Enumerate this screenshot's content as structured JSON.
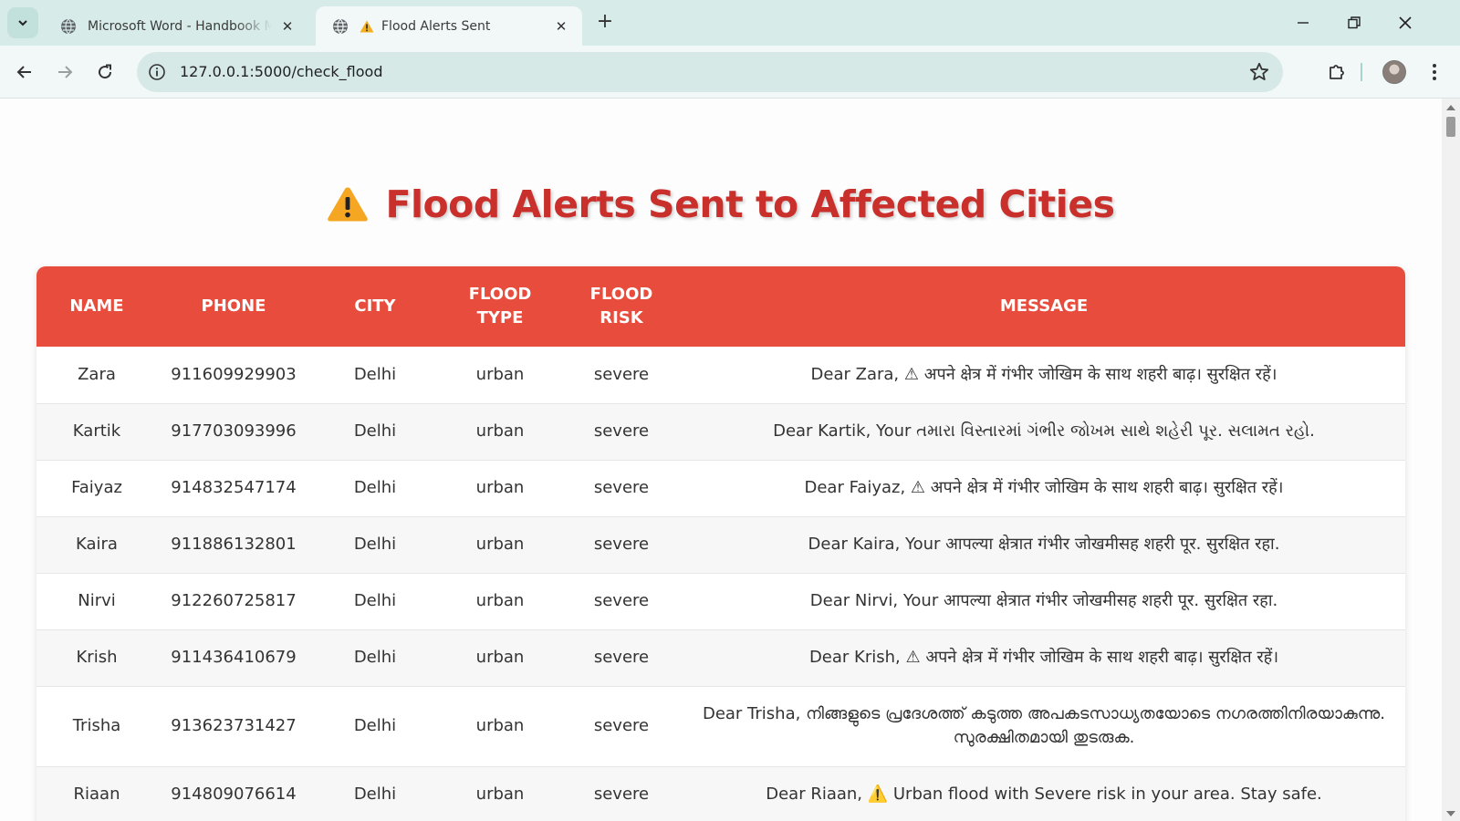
{
  "browser": {
    "tabs": [
      {
        "title": "Microsoft Word - Handbook M",
        "active": false
      },
      {
        "title": "Flood Alerts Sent",
        "warning_icon": "⚠️",
        "active": true
      }
    ],
    "url": "127.0.0.1:5000/check_flood"
  },
  "page": {
    "heading_icon": "⚠️",
    "heading": "Flood Alerts Sent to Affected Cities",
    "accent_color": "#e74c3c",
    "heading_color": "#c9302c"
  },
  "table": {
    "headers": {
      "name": "NAME",
      "phone": "PHONE",
      "city": "CITY",
      "flood_type": "FLOOD TYPE",
      "flood_risk": "FLOOD RISK",
      "message": "MESSAGE"
    },
    "rows": [
      {
        "name": "Zara",
        "phone": "911609929903",
        "city": "Delhi",
        "flood_type": "urban",
        "flood_risk": "severe",
        "message": "Dear Zara, ⚠ अपने क्षेत्र में गंभीर जोखिम के साथ शहरी बाढ़। सुरक्षित रहें।"
      },
      {
        "name": "Kartik",
        "phone": "917703093996",
        "city": "Delhi",
        "flood_type": "urban",
        "flood_risk": "severe",
        "message": "Dear Kartik, Your તમારા વિસ્તારમાં ગંભીર જોખમ સાથે શહેરી પૂર. સલામત રહો."
      },
      {
        "name": "Faiyaz",
        "phone": "914832547174",
        "city": "Delhi",
        "flood_type": "urban",
        "flood_risk": "severe",
        "message": "Dear Faiyaz, ⚠ अपने क्षेत्र में गंभीर जोखिम के साथ शहरी बाढ़। सुरक्षित रहें।"
      },
      {
        "name": "Kaira",
        "phone": "911886132801",
        "city": "Delhi",
        "flood_type": "urban",
        "flood_risk": "severe",
        "message": "Dear Kaira, Your आपल्या क्षेत्रात गंभीर जोखमीसह शहरी पूर. सुरक्षित रहा."
      },
      {
        "name": "Nirvi",
        "phone": "912260725817",
        "city": "Delhi",
        "flood_type": "urban",
        "flood_risk": "severe",
        "message": "Dear Nirvi, Your आपल्या क्षेत्रात गंभीर जोखमीसह शहरी पूर. सुरक्षित रहा."
      },
      {
        "name": "Krish",
        "phone": "911436410679",
        "city": "Delhi",
        "flood_type": "urban",
        "flood_risk": "severe",
        "message": "Dear Krish, ⚠ अपने क्षेत्र में गंभीर जोखिम के साथ शहरी बाढ़। सुरक्षित रहें।"
      },
      {
        "name": "Trisha",
        "phone": "913623731427",
        "city": "Delhi",
        "flood_type": "urban",
        "flood_risk": "severe",
        "message": "Dear Trisha, നിങ്ങളുടെ പ്രദേശത്ത് കടുത്ത അപകടസാധ്യതയോടെ നഗരത്തിനിരയാകുന്നു. സുരക്ഷിതമായി തുടരുക."
      },
      {
        "name": "Riaan",
        "phone": "914809076614",
        "city": "Delhi",
        "flood_type": "urban",
        "flood_risk": "severe",
        "message": "Dear Riaan, ⚠️ Urban flood with Severe risk in your area. Stay safe."
      }
    ]
  }
}
